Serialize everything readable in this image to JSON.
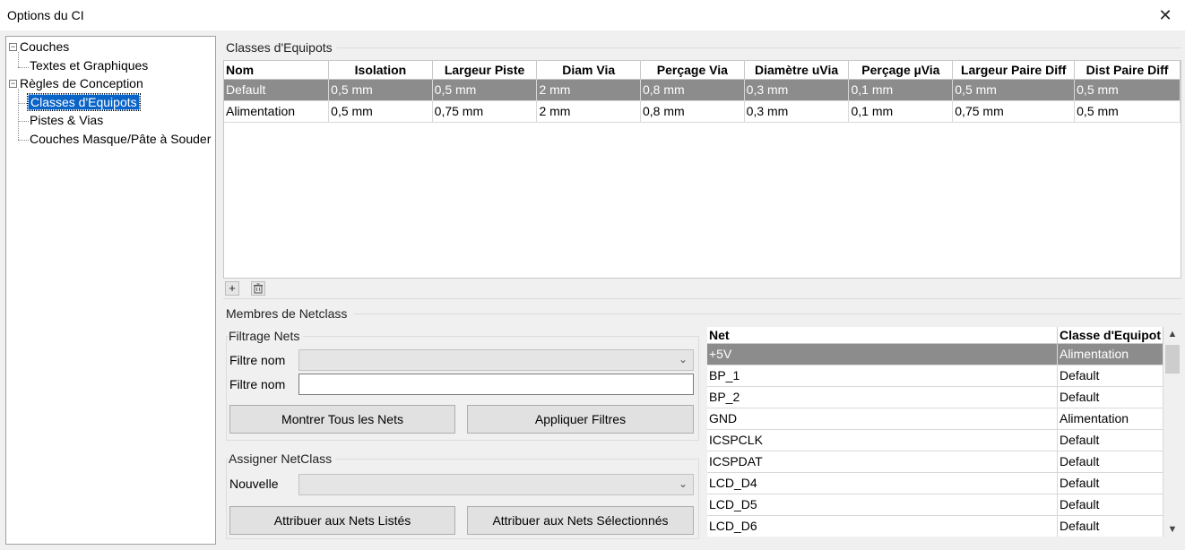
{
  "window": {
    "title": "Options du CI",
    "close_glyph": "✕"
  },
  "tree": {
    "items": [
      {
        "label": "Couches"
      },
      {
        "label": "Textes et Graphiques"
      },
      {
        "label": "Règles de Conception"
      },
      {
        "label": "Classes d'Equipots"
      },
      {
        "label": "Pistes & Vias"
      },
      {
        "label": "Couches Masque/Pâte à Souder"
      }
    ],
    "expander": "−"
  },
  "netclasses": {
    "group_label": "Classes d'Equipots",
    "columns": [
      "Nom",
      "Isolation",
      "Largeur Piste",
      "Diam Via",
      "Perçage Via",
      "Diamètre uVia",
      "Perçage µVia",
      "Largeur Paire Diff",
      "Dist Paire Diff"
    ],
    "rows": [
      [
        "Default",
        "0,5 mm",
        "0,5 mm",
        "2 mm",
        "0,8 mm",
        "0,3 mm",
        "0,1 mm",
        "0,5 mm",
        "0,5 mm"
      ],
      [
        "Alimentation",
        "0,5 mm",
        "0,75 mm",
        "2 mm",
        "0,8 mm",
        "0,3 mm",
        "0,1 mm",
        "0,75 mm",
        "0,5 mm"
      ]
    ],
    "add_glyph": "+",
    "delete_glyph": "🗑"
  },
  "members": {
    "group_label": "Membres de Netclass",
    "filter": {
      "group_label": "Filtrage Nets",
      "row1_label": "Filtre nom",
      "row2_label": "Filtre nom",
      "combo_value": "",
      "text_value": "",
      "show_all_button": "Montrer Tous les Nets",
      "apply_button": "Appliquer Filtres"
    },
    "assign": {
      "group_label": "Assigner NetClass",
      "new_label": "Nouvelle",
      "combo_value": "",
      "assign_listed_button": "Attribuer aux Nets Listés",
      "assign_selected_button": "Attribuer aux Nets Sélectionnés"
    },
    "nets": {
      "columns": [
        "Net",
        "Classe d'Equipot"
      ],
      "rows": [
        [
          "+5V",
          "Alimentation"
        ],
        [
          "BP_1",
          "Default"
        ],
        [
          "BP_2",
          "Default"
        ],
        [
          "GND",
          "Alimentation"
        ],
        [
          "ICSPCLK",
          "Default"
        ],
        [
          "ICSPDAT",
          "Default"
        ],
        [
          "LCD_D4",
          "Default"
        ],
        [
          "LCD_D5",
          "Default"
        ],
        [
          "LCD_D6",
          "Default"
        ]
      ]
    }
  }
}
